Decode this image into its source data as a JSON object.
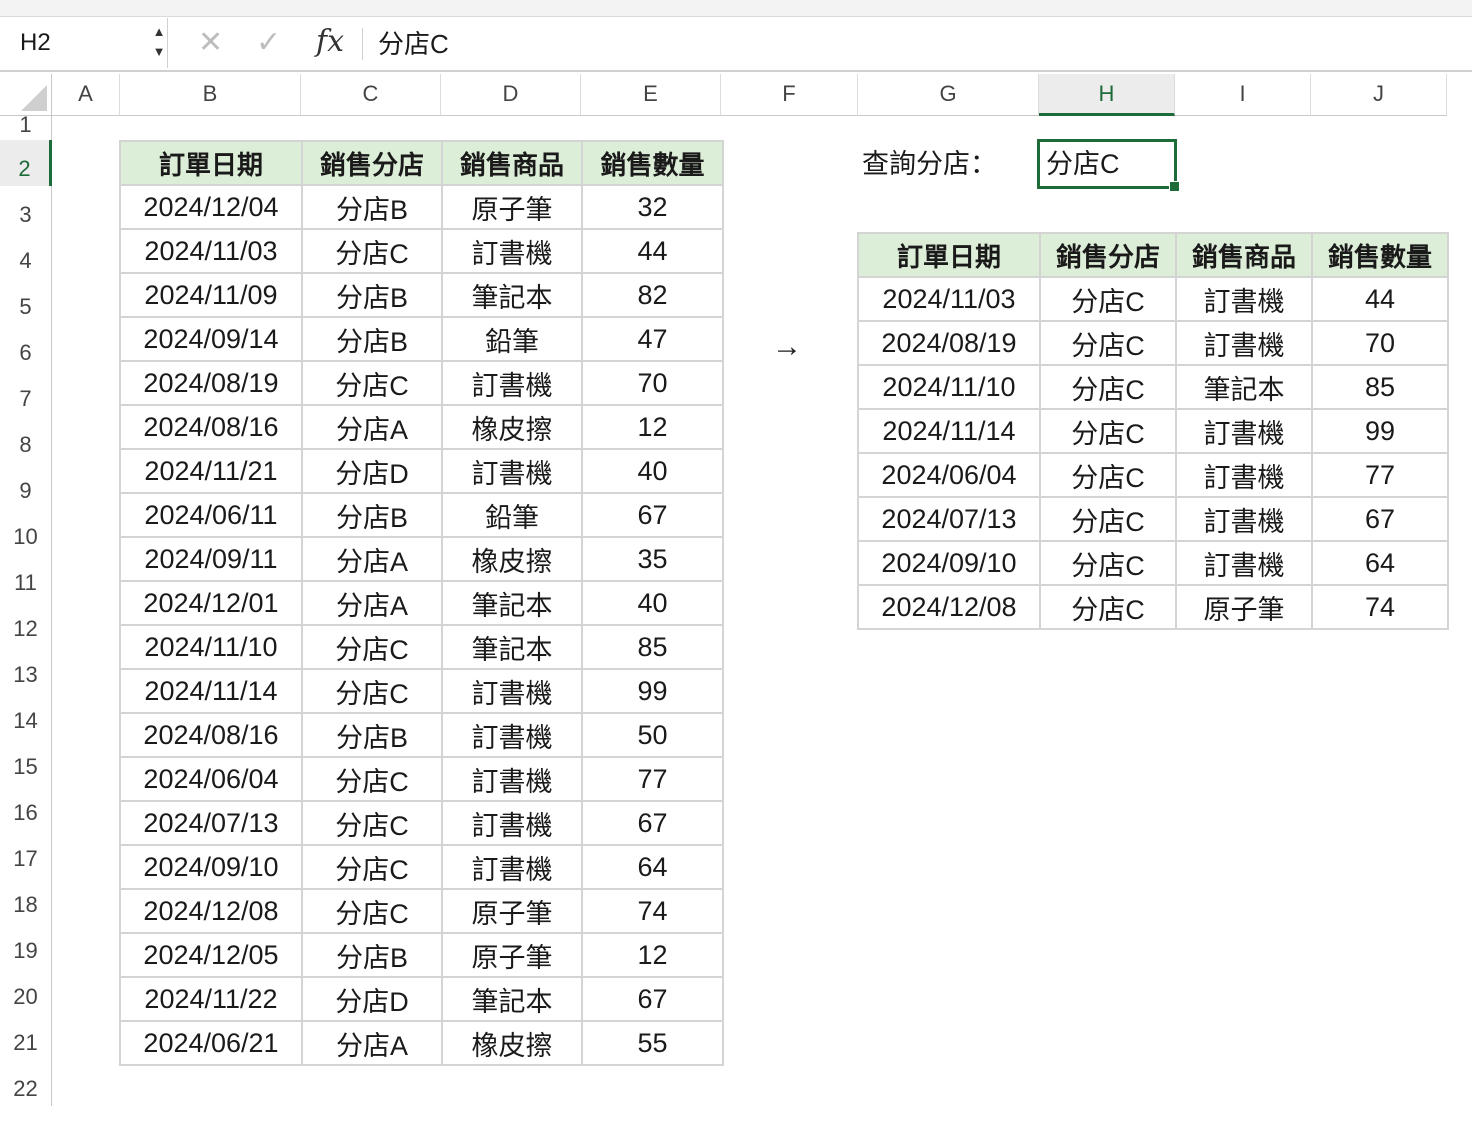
{
  "formula_bar": {
    "name_box": "H2",
    "cancel_icon": "✕",
    "confirm_icon": "✓",
    "fx_label": "fx",
    "formula": "分店C"
  },
  "grid": {
    "columns": [
      "A",
      "B",
      "C",
      "D",
      "E",
      "F",
      "G",
      "H",
      "I",
      "J"
    ],
    "rows": [
      "1",
      "2",
      "3",
      "4",
      "5",
      "6",
      "7",
      "8",
      "9",
      "10",
      "11",
      "12",
      "13",
      "14",
      "15",
      "16",
      "17",
      "18",
      "19",
      "20",
      "21",
      "22"
    ],
    "active_column": "H",
    "active_row": "2"
  },
  "source_table": {
    "headers": [
      "訂單日期",
      "銷售分店",
      "銷售商品",
      "銷售數量"
    ],
    "rows": [
      [
        "2024/12/04",
        "分店B",
        "原子筆",
        "32"
      ],
      [
        "2024/11/03",
        "分店C",
        "訂書機",
        "44"
      ],
      [
        "2024/11/09",
        "分店B",
        "筆記本",
        "82"
      ],
      [
        "2024/09/14",
        "分店B",
        "鉛筆",
        "47"
      ],
      [
        "2024/08/19",
        "分店C",
        "訂書機",
        "70"
      ],
      [
        "2024/08/16",
        "分店A",
        "橡皮擦",
        "12"
      ],
      [
        "2024/11/21",
        "分店D",
        "訂書機",
        "40"
      ],
      [
        "2024/06/11",
        "分店B",
        "鉛筆",
        "67"
      ],
      [
        "2024/09/11",
        "分店A",
        "橡皮擦",
        "35"
      ],
      [
        "2024/12/01",
        "分店A",
        "筆記本",
        "40"
      ],
      [
        "2024/11/10",
        "分店C",
        "筆記本",
        "85"
      ],
      [
        "2024/11/14",
        "分店C",
        "訂書機",
        "99"
      ],
      [
        "2024/08/16",
        "分店B",
        "訂書機",
        "50"
      ],
      [
        "2024/06/04",
        "分店C",
        "訂書機",
        "77"
      ],
      [
        "2024/07/13",
        "分店C",
        "訂書機",
        "67"
      ],
      [
        "2024/09/10",
        "分店C",
        "訂書機",
        "64"
      ],
      [
        "2024/12/08",
        "分店C",
        "原子筆",
        "74"
      ],
      [
        "2024/12/05",
        "分店B",
        "原子筆",
        "12"
      ],
      [
        "2024/11/22",
        "分店D",
        "筆記本",
        "67"
      ],
      [
        "2024/06/21",
        "分店A",
        "橡皮擦",
        "55"
      ]
    ]
  },
  "arrow": "→",
  "query": {
    "label": "查詢分店：",
    "value": "分店C"
  },
  "result_table": {
    "headers": [
      "訂單日期",
      "銷售分店",
      "銷售商品",
      "銷售數量"
    ],
    "rows": [
      [
        "2024/11/03",
        "分店C",
        "訂書機",
        "44"
      ],
      [
        "2024/08/19",
        "分店C",
        "訂書機",
        "70"
      ],
      [
        "2024/11/10",
        "分店C",
        "筆記本",
        "85"
      ],
      [
        "2024/11/14",
        "分店C",
        "訂書機",
        "99"
      ],
      [
        "2024/06/04",
        "分店C",
        "訂書機",
        "77"
      ],
      [
        "2024/07/13",
        "分店C",
        "訂書機",
        "67"
      ],
      [
        "2024/09/10",
        "分店C",
        "訂書機",
        "64"
      ],
      [
        "2024/12/08",
        "分店C",
        "原子筆",
        "74"
      ]
    ]
  },
  "colors": {
    "header_fill": "#ddeed8",
    "selection": "#1e6b3a",
    "gridline": "#d4d4d4"
  }
}
